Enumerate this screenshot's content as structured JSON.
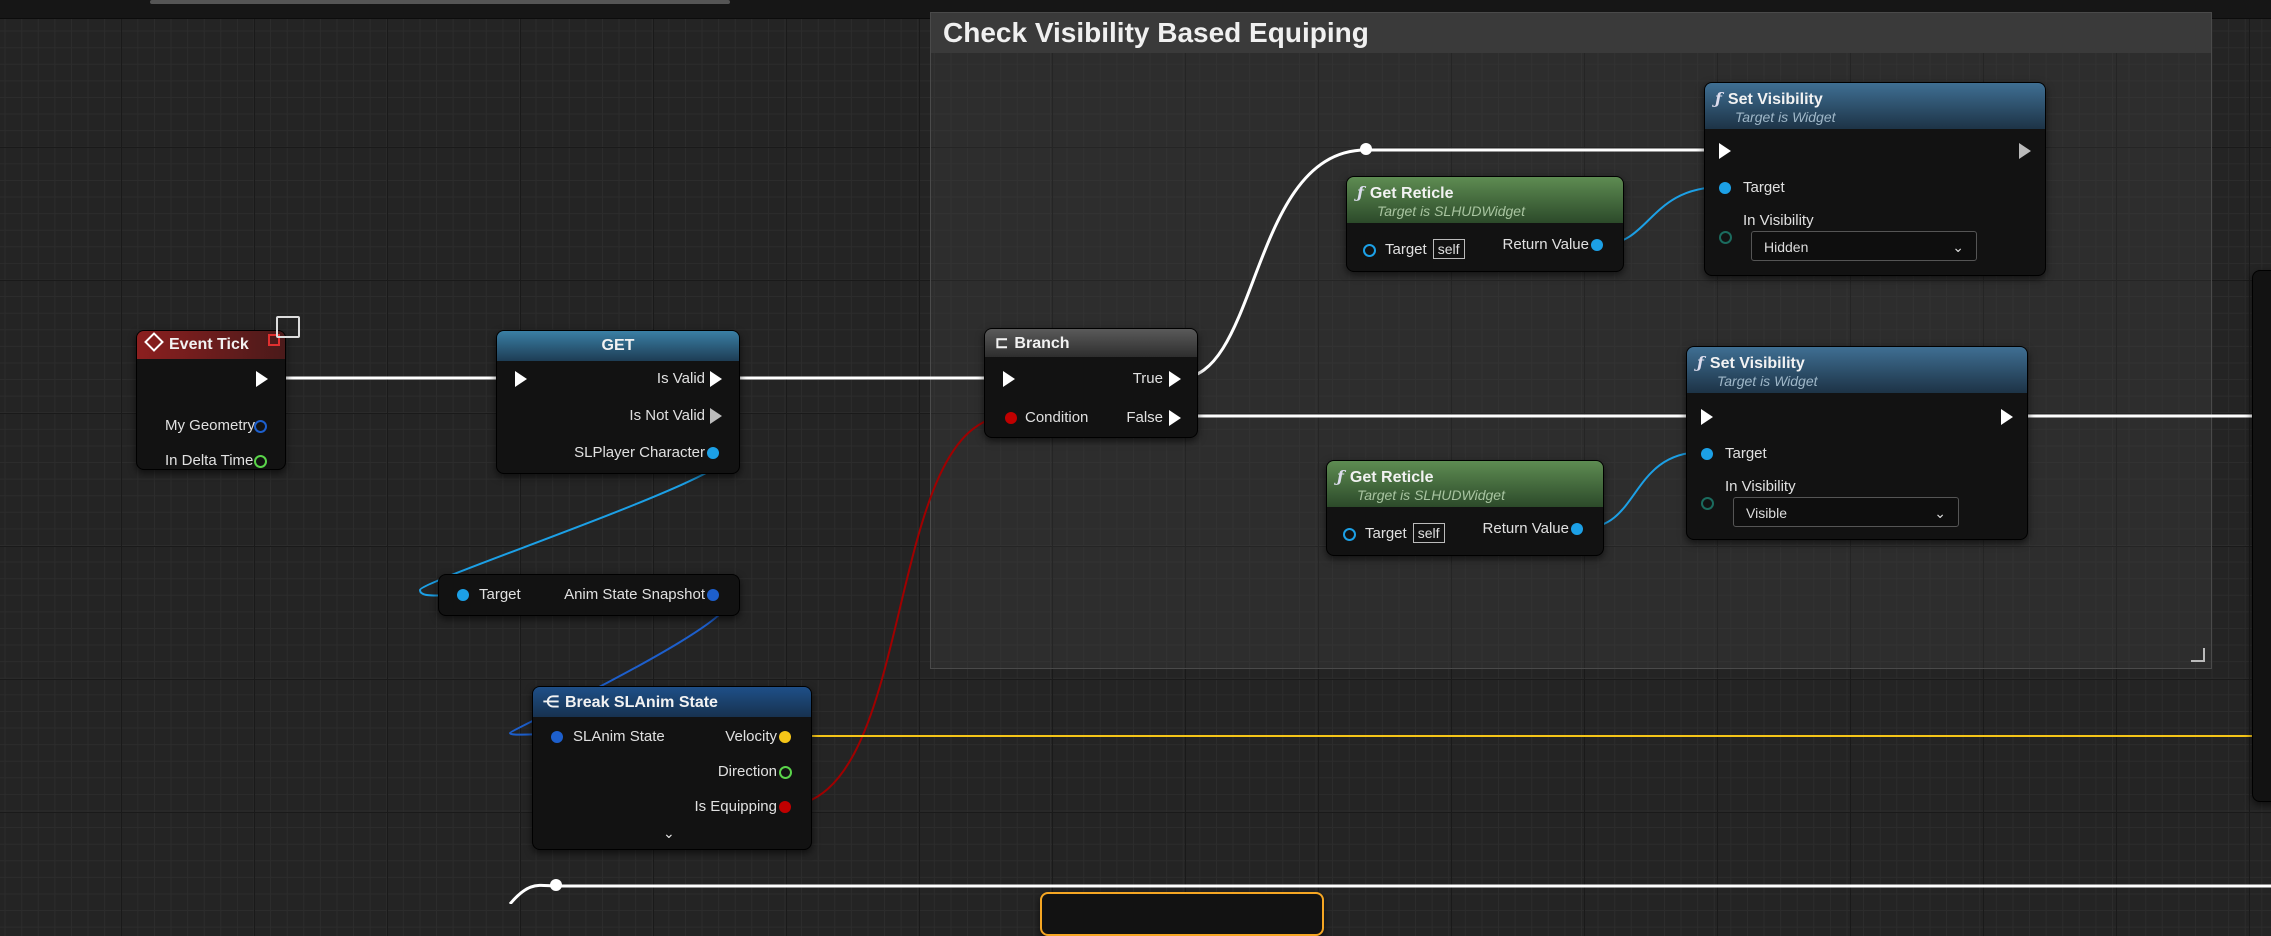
{
  "comment": {
    "title": "Check Visibility Based Equiping"
  },
  "event_tick": {
    "title": "Event Tick",
    "pins": {
      "my_geometry": "My Geometry",
      "in_delta_time": "In Delta Time"
    }
  },
  "get_node": {
    "title": "GET",
    "pins": {
      "is_valid": "Is Valid",
      "is_not_valid": "Is Not Valid",
      "player": "SLPlayer Character"
    }
  },
  "anim_snapshot": {
    "pins": {
      "target": "Target",
      "output": "Anim State Snapshot"
    }
  },
  "break_state": {
    "title": "Break SLAnim State",
    "pins": {
      "input": "SLAnim State",
      "velocity": "Velocity",
      "direction": "Direction",
      "is_equipping": "Is Equipping"
    },
    "expand_icon": "chevron-down-icon"
  },
  "branch": {
    "title": "Branch",
    "pins": {
      "condition": "Condition",
      "true": "True",
      "false": "False"
    }
  },
  "get_reticle_1": {
    "title": "Get Reticle",
    "subtitle": "Target is SLHUDWidget",
    "target": "Target",
    "self": "self",
    "return": "Return Value"
  },
  "get_reticle_2": {
    "title": "Get Reticle",
    "subtitle": "Target is SLHUDWidget",
    "target": "Target",
    "self": "self",
    "return": "Return Value"
  },
  "set_visibility_1": {
    "title": "Set Visibility",
    "subtitle": "Target is Widget",
    "target": "Target",
    "in_visibility": "In Visibility",
    "value": "Hidden"
  },
  "set_visibility_2": {
    "title": "Set Visibility",
    "subtitle": "Target is Widget",
    "target": "Target",
    "in_visibility": "In Visibility",
    "value": "Visible"
  },
  "colors": {
    "event_header": "#8c1f1f",
    "function_header": "#3f6f93",
    "pure_header": "#4c7a45",
    "object_pin": "#1ca0e6",
    "struct_pin": "#1d5fcc",
    "vector_pin": "#f5c518",
    "bool_pin": "#a00000",
    "float_pin": "#5ad44a"
  }
}
